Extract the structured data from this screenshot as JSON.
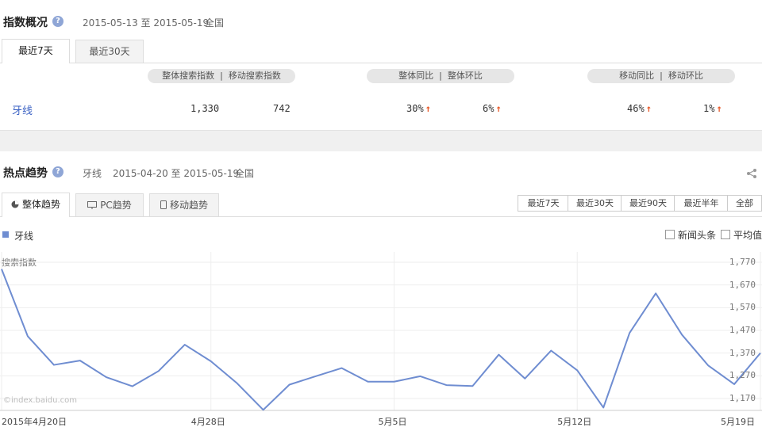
{
  "overview": {
    "title": "指数概况",
    "help": "?",
    "date_range": "2015-05-13 至 2015-05-19",
    "region": "全国",
    "tabs": [
      "最近7天",
      "最近30天"
    ],
    "headers": {
      "pill1_left": "整体搜索指数",
      "pill1_right": "移动搜索指数",
      "pill2_left": "整体同比",
      "pill2_right": "整体环比",
      "pill3_left": "移动同比",
      "pill3_right": "移动环比",
      "sep": "|"
    },
    "row": {
      "keyword": "牙线",
      "overall_index": "1,330",
      "mobile_index": "742",
      "overall_yoy": "30%",
      "overall_mom": "6%",
      "mobile_yoy": "46%",
      "mobile_mom": "1%",
      "arrow": "↑"
    }
  },
  "trend": {
    "title": "热点趋势",
    "help": "?",
    "keyword": "牙线",
    "date_range": "2015-04-20 至 2015-05-19",
    "region": "全国",
    "tabs": [
      "整体趋势",
      "PC趋势",
      "移动趋势"
    ],
    "range_buttons": [
      "最近7天",
      "最近30天",
      "最近90天",
      "最近半年",
      "全部"
    ],
    "legend": "牙线",
    "checkbox_news": "新闻头条",
    "checkbox_avg": "平均值",
    "watermark": "©index.baidu.com",
    "colors": {
      "line": "#6f8dd1",
      "arrow": "#e85a2a"
    }
  },
  "chart_data": {
    "type": "line",
    "ylabel": "搜索指数",
    "y_ticks": [
      "1,770",
      "1,670",
      "1,570",
      "1,470",
      "1,370",
      "1,270",
      "1,170"
    ],
    "x_ticks": [
      "2015年4月20日",
      "4月28日",
      "5月5日",
      "5月12日",
      "5月19日"
    ],
    "x_tick_index": [
      0,
      8,
      15,
      22,
      29
    ],
    "ylim": [
      1100,
      1800
    ],
    "x": [
      "4/20",
      "4/21",
      "4/22",
      "4/23",
      "4/24",
      "4/25",
      "4/26",
      "4/27",
      "4/28",
      "4/29",
      "4/30",
      "5/1",
      "5/2",
      "5/3",
      "5/4",
      "5/5",
      "5/6",
      "5/7",
      "5/8",
      "5/9",
      "5/10",
      "5/11",
      "5/12",
      "5/13",
      "5/14",
      "5/15",
      "5/16",
      "5/17",
      "5/18",
      "5/19"
    ],
    "series": [
      {
        "name": "牙线",
        "values": [
          1740,
          1444,
          1318,
          1337,
          1264,
          1224,
          1291,
          1407,
          1334,
          1237,
          1120,
          1231,
          1268,
          1304,
          1244,
          1244,
          1268,
          1229,
          1225,
          1363,
          1258,
          1381,
          1294,
          1130,
          1459,
          1633,
          1451,
          1316,
          1233,
          1370
        ]
      }
    ]
  }
}
